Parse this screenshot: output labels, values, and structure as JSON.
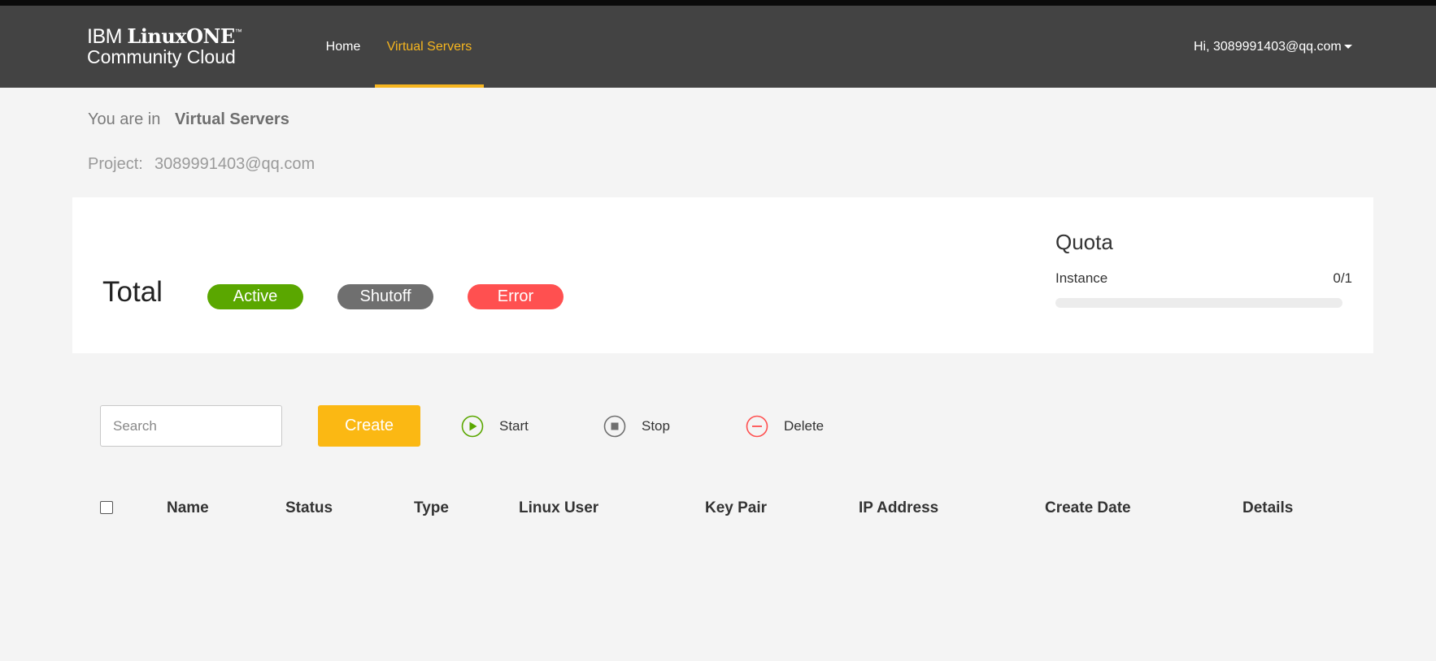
{
  "header": {
    "logo": {
      "brand": "IBM",
      "product": "LinuxONE",
      "tm": "™",
      "subtitle": "Community Cloud"
    },
    "nav": [
      {
        "label": "Home",
        "active": false
      },
      {
        "label": "Virtual Servers",
        "active": true
      }
    ],
    "user_greeting": "Hi, 3089991403@qq.com"
  },
  "breadcrumb": {
    "prefix": "You are in",
    "current": "Virtual Servers"
  },
  "project": {
    "label": "Project:",
    "value": "3089991403@qq.com"
  },
  "summary": {
    "total_label": "Total",
    "badges": [
      {
        "label": "Active",
        "color": "#5aa700"
      },
      {
        "label": "Shutoff",
        "color": "#6f6f6f"
      },
      {
        "label": "Error",
        "color": "#ff5050"
      }
    ]
  },
  "quota": {
    "title": "Quota",
    "label": "Instance",
    "value": "0/1",
    "used_fraction": 0
  },
  "toolbar": {
    "search_placeholder": "Search",
    "create_label": "Create",
    "actions": [
      {
        "label": "Start",
        "icon": "play-circle-icon",
        "color": "#5aa700"
      },
      {
        "label": "Stop",
        "icon": "stop-circle-icon",
        "color": "#6f6f6f"
      },
      {
        "label": "Delete",
        "icon": "minus-circle-icon",
        "color": "#ff5050"
      }
    ]
  },
  "table": {
    "columns": [
      "Name",
      "Status",
      "Type",
      "Linux User",
      "Key Pair",
      "IP Address",
      "Create Date",
      "Details"
    ],
    "rows": []
  },
  "colors": {
    "accent": "#f6b51f",
    "header_bg": "#434343",
    "page_bg": "#f4f4f4",
    "create_button": "#fbb813"
  }
}
